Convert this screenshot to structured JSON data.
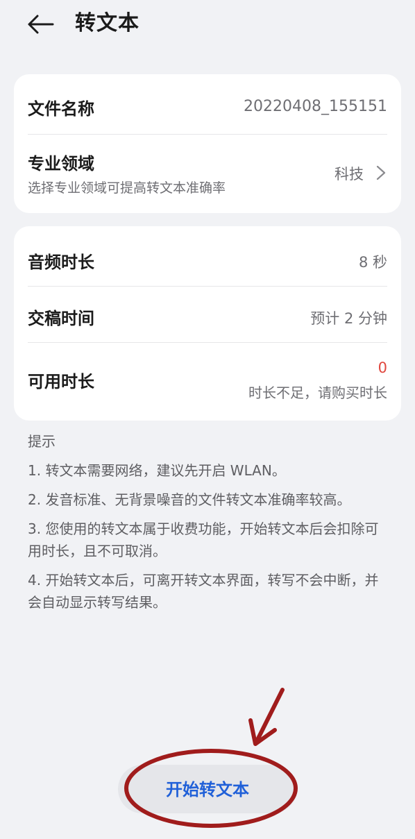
{
  "header": {
    "title": "转文本"
  },
  "file_card": {
    "file_name_label": "文件名称",
    "file_name_value": "20220408_155151",
    "domain_label": "专业领域",
    "domain_hint": "选择专业领域可提高转文本准确率",
    "domain_value": "科技"
  },
  "info_card": {
    "duration_label": "音频时长",
    "duration_value": "8 秒",
    "delivery_label": "交稿时间",
    "delivery_value": "预计 2 分钟",
    "available_label": "可用时长",
    "available_value": "0",
    "available_note": "时长不足，请购买时长"
  },
  "tips": {
    "title": "提示",
    "items": [
      "1. 转文本需要网络，建议先开启 WLAN。",
      "2. 发音标准、无背景噪音的文件转文本准确率较高。",
      "3. 您使用的转文本属于收费功能，开始转文本后会扣除可用时长，且不可取消。",
      "4. 开始转文本后，可离开转文本界面，转写不会中断，并会自动显示转写结果。"
    ]
  },
  "start_button": {
    "label": "开始转文本"
  },
  "colors": {
    "accent": "#2060d8",
    "warning": "#e0473e",
    "annotation": "#a01c1c",
    "background": "#f1f2f5"
  }
}
